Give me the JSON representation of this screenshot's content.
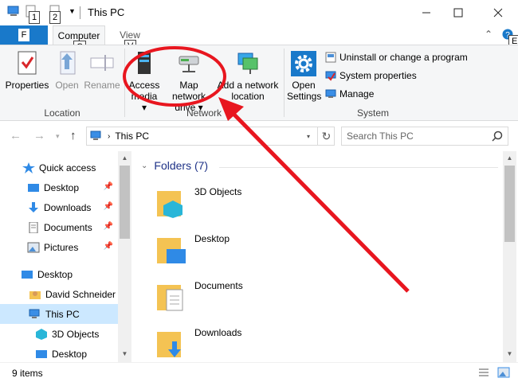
{
  "window": {
    "title": "This PC",
    "keytips": {
      "qat1": "1",
      "qat2": "2",
      "file": "F",
      "computer": "C",
      "view": "V",
      "help": "E"
    }
  },
  "ribbon": {
    "file_tab": "F",
    "tabs": [
      {
        "label": "Computer",
        "active": true
      },
      {
        "label": "View",
        "active": false
      }
    ],
    "location_group": {
      "label": "Location",
      "buttons": [
        {
          "label": "Properties"
        },
        {
          "label": "Open"
        },
        {
          "label": "Rename"
        }
      ]
    },
    "network_group": {
      "label": "Network",
      "buttons": [
        {
          "line1": "Access",
          "line2": "media"
        },
        {
          "line1": "Map network",
          "line2": "drive"
        },
        {
          "line1": "Add a network",
          "line2": "location"
        }
      ]
    },
    "system_group": {
      "label": "System",
      "open_settings": {
        "line1": "Open",
        "line2": "Settings"
      },
      "items": [
        {
          "label": "Uninstall or change a program"
        },
        {
          "label": "System properties"
        },
        {
          "label": "Manage"
        }
      ]
    }
  },
  "address": {
    "path": "This PC",
    "search_placeholder": "Search This PC"
  },
  "nav": {
    "items": [
      {
        "label": "Quick access"
      },
      {
        "label": "Desktop"
      },
      {
        "label": "Downloads"
      },
      {
        "label": "Documents"
      },
      {
        "label": "Pictures"
      },
      {
        "label": "Desktop"
      },
      {
        "label": "David Schneider"
      },
      {
        "label": "This PC"
      },
      {
        "label": "3D Objects"
      },
      {
        "label": "Desktop"
      }
    ]
  },
  "content": {
    "section_title": "Folders (7)",
    "folders": [
      {
        "name": "3D Objects"
      },
      {
        "name": "Desktop"
      },
      {
        "name": "Documents"
      },
      {
        "name": "Downloads"
      }
    ]
  },
  "status": {
    "items_count": "9 items"
  },
  "colors": {
    "accent": "#1979ca",
    "selected": "#cce8ff",
    "annotation": "#e8161f",
    "folder": "#f4c353"
  }
}
